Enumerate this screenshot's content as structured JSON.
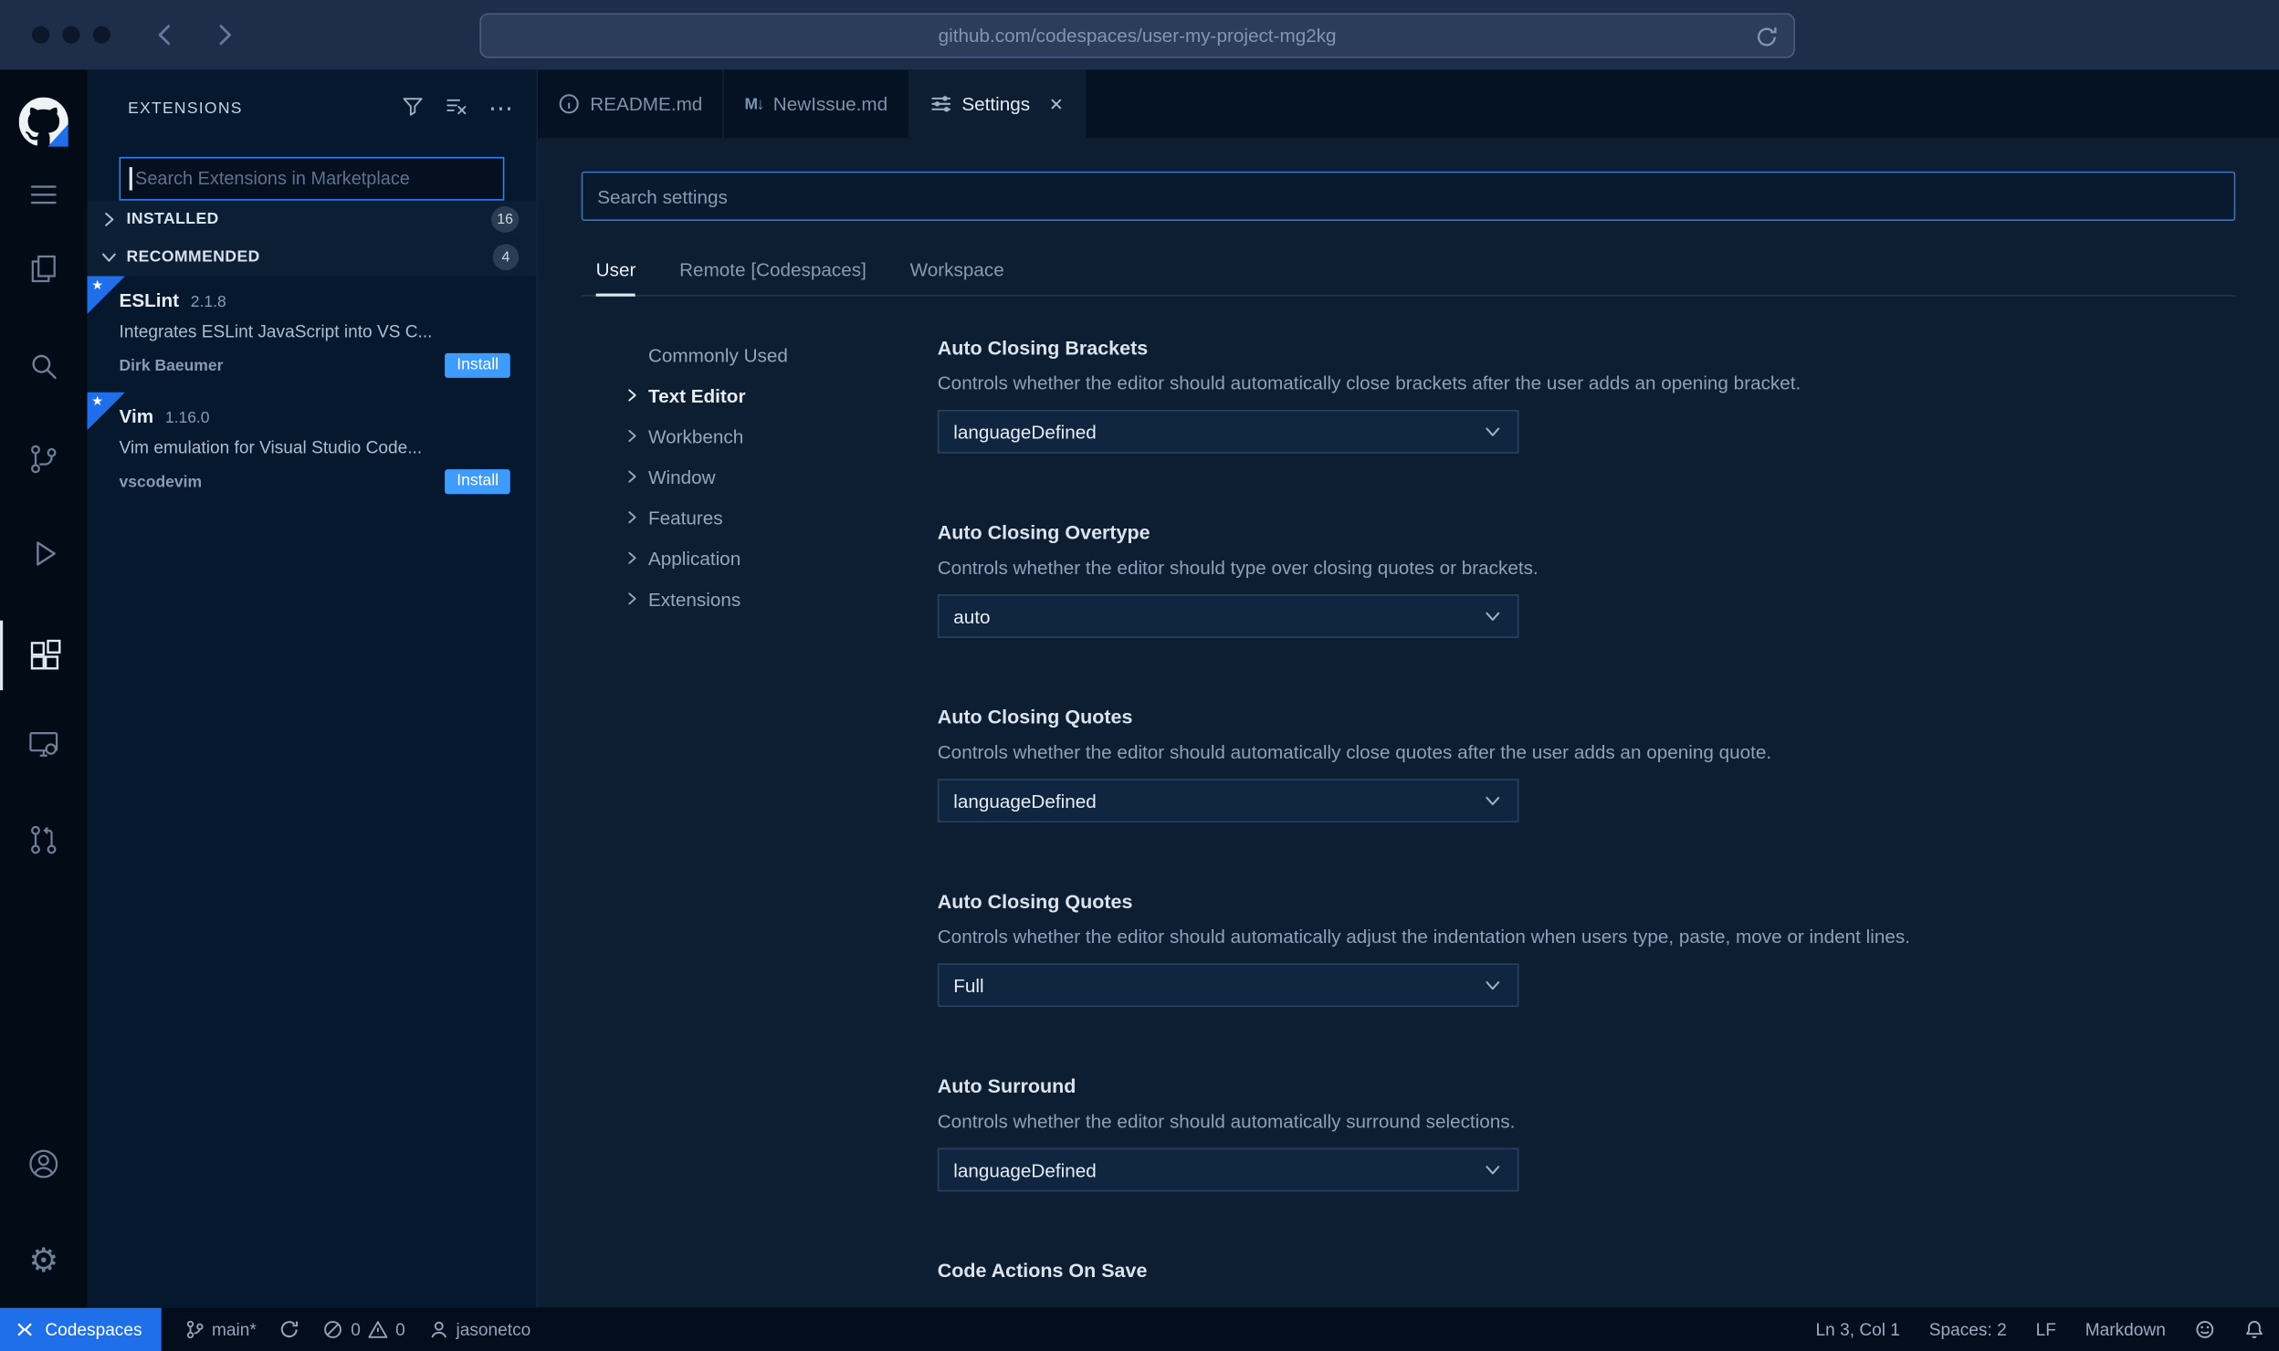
{
  "browser": {
    "url": "github.com/codespaces/user-my-project-mg2kg"
  },
  "colors": {
    "accent_blue": "#2f81f7",
    "install_button": "#3f9cff",
    "statusbar_remote": "#1f6feb",
    "editor_background": "#0d1d32",
    "sidebar_background": "#06182d"
  },
  "icons": {
    "ellipsis": "⋯",
    "close": "✕",
    "star": "★",
    "markdown_tab": "M↓",
    "gear": "⚙"
  },
  "sidebar": {
    "title": "EXTENSIONS",
    "search_placeholder": "Search Extensions in Marketplace",
    "sections": [
      {
        "label": "INSTALLED",
        "count": "16"
      },
      {
        "label": "RECOMMENDED",
        "count": "4"
      }
    ],
    "extensions": [
      {
        "name": "ESLint",
        "version": "2.1.8",
        "description": "Integrates ESLint JavaScript into VS C...",
        "publisher": "Dirk Baeumer",
        "action": "Install"
      },
      {
        "name": "Vim",
        "version": "1.16.0",
        "description": "Vim emulation for Visual Studio Code...",
        "publisher": "vscodevim",
        "action": "Install"
      }
    ]
  },
  "editor": {
    "tabs": [
      {
        "label": "README.md"
      },
      {
        "label": "NewIssue.md"
      },
      {
        "label": "Settings"
      }
    ]
  },
  "settings": {
    "search_placeholder": "Search settings",
    "scopes": [
      {
        "label": "User"
      },
      {
        "label": "Remote [Codespaces]"
      },
      {
        "label": "Workspace"
      }
    ],
    "toc": [
      {
        "label": "Commonly Used"
      },
      {
        "label": "Text Editor"
      },
      {
        "label": "Workbench"
      },
      {
        "label": "Window"
      },
      {
        "label": "Features"
      },
      {
        "label": "Application"
      },
      {
        "label": "Extensions"
      }
    ],
    "items": [
      {
        "title": "Auto Closing Brackets",
        "description": "Controls whether the editor should automatically close brackets after the user adds an opening bracket.",
        "value": "languageDefined"
      },
      {
        "title": "Auto Closing Overtype",
        "description": "Controls whether the editor should type over closing quotes or brackets.",
        "value": "auto"
      },
      {
        "title": "Auto Closing Quotes",
        "description": "Controls whether the editor should automatically close quotes after the user adds an opening quote.",
        "value": "languageDefined"
      },
      {
        "title": "Auto Closing Quotes",
        "description": "Controls whether the editor should automatically adjust the indentation when users type, paste, move or indent lines.",
        "value": "Full"
      },
      {
        "title": "Auto Surround",
        "description": "Controls whether the editor should automatically surround selections.",
        "value": "languageDefined"
      },
      {
        "title": "Code Actions On Save"
      }
    ]
  },
  "status_bar": {
    "codespaces": "Codespaces",
    "branch": "main*",
    "errors": "0",
    "warnings": "0",
    "user": "jasonetco",
    "cursor": "Ln 3, Col 1",
    "indent": "Spaces: 2",
    "eol": "LF",
    "language": "Markdown"
  }
}
